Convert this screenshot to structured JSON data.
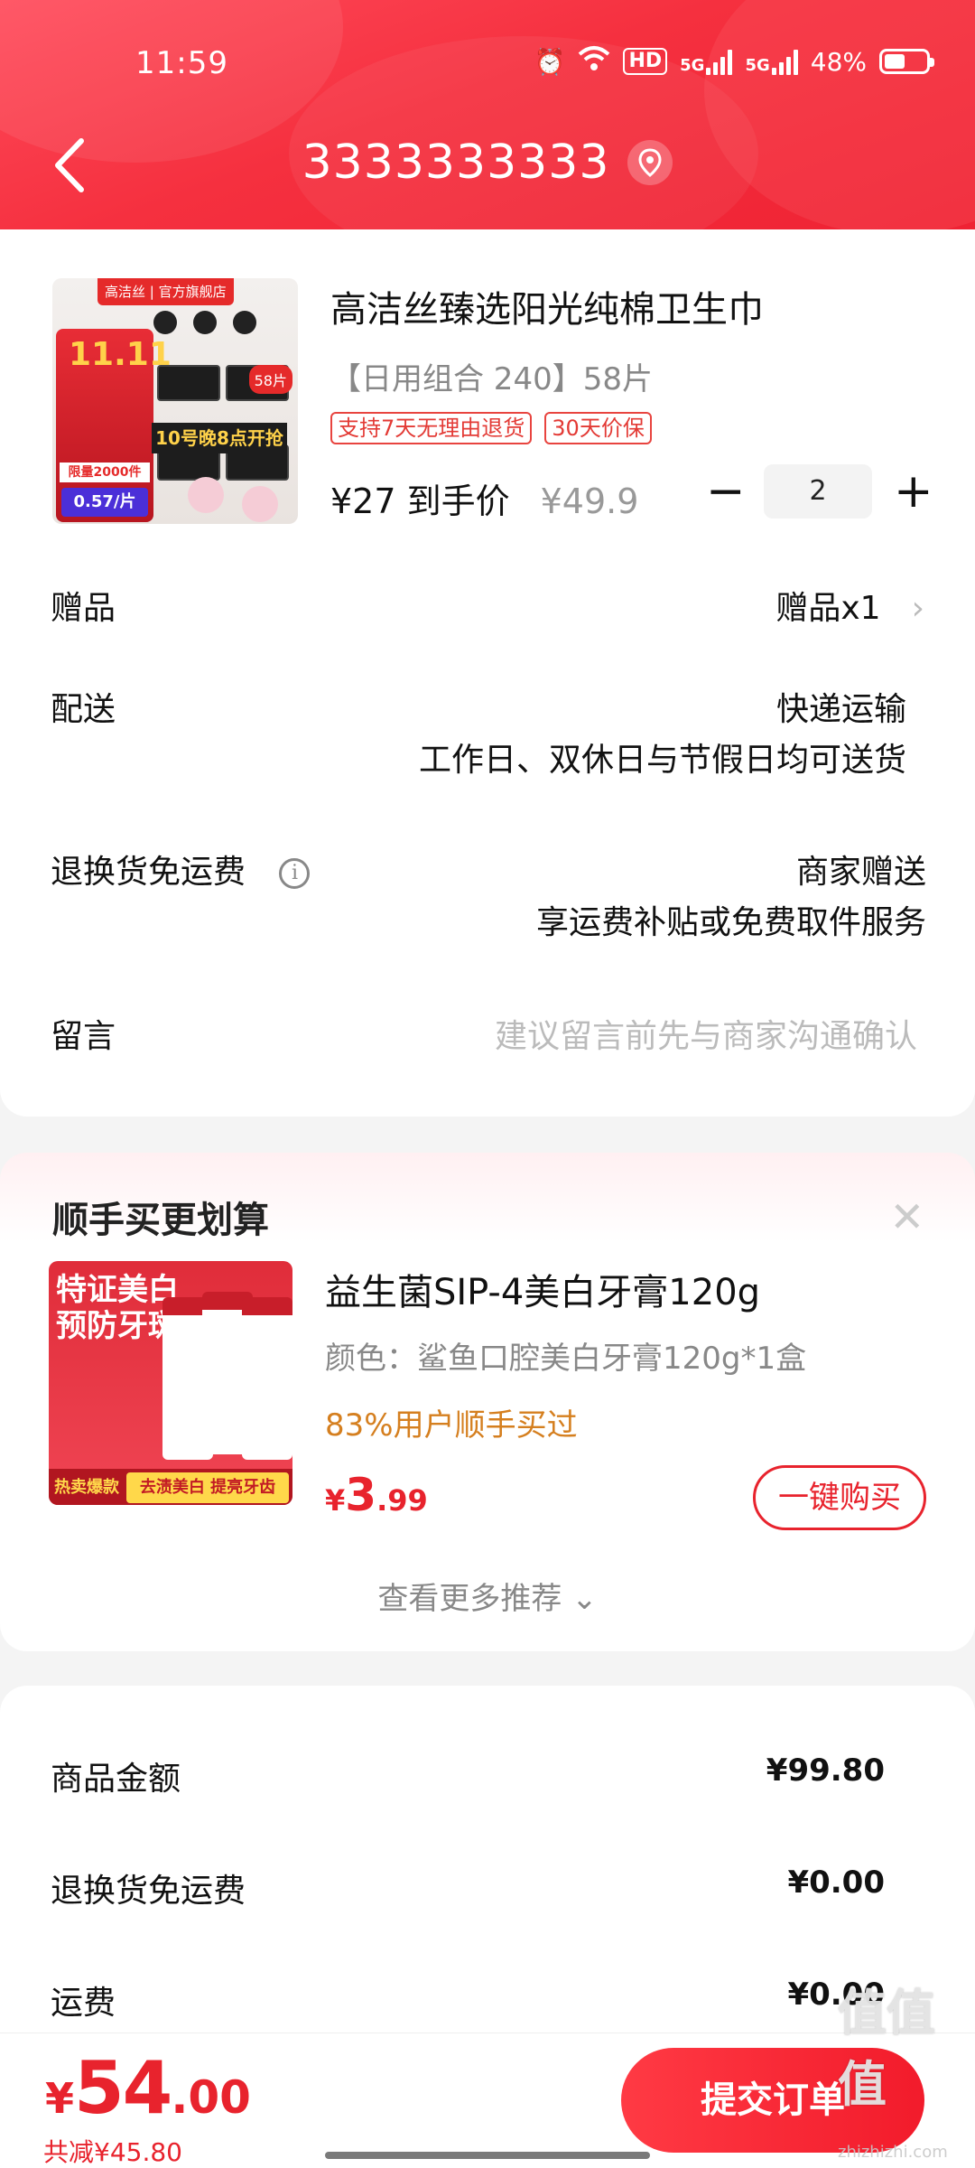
{
  "status_bar": {
    "time": "11:59",
    "hd": "HD",
    "net1": "5G",
    "net2": "5G",
    "battery": "48%"
  },
  "header": {
    "title": "3333333333"
  },
  "product": {
    "title": "高洁丝臻选阳光纯棉卫生巾",
    "spec": "【日用组合 240】58片",
    "tags": [
      "支持7天无理由退货",
      "30天价保"
    ],
    "final_price": "¥27 到手价",
    "original_price": "¥49.9",
    "quantity": "2",
    "minus": "−",
    "plus": "+",
    "image": {
      "store_tag": "高洁丝 | 官方旗舰店",
      "promo": "11.11",
      "limit": "限量2000件",
      "unit_price": "0.57/片",
      "count": "58片",
      "event": "10号晚8点开抢"
    }
  },
  "details": {
    "gift_label": "赠品",
    "gift_value": "赠品x1",
    "delivery_label": "配送",
    "delivery_value": "快递运输",
    "delivery_sub": "工作日、双休日与节假日均可送货",
    "return_label": "退换货免运费",
    "return_value": "商家赠送",
    "return_sub": "享运费补贴或免费取件服务",
    "message_label": "留言",
    "message_placeholder": "建议留言前先与商家沟通确认"
  },
  "recommend": {
    "title": "顺手买更划算",
    "item_title": "益生菌SIP-4美白牙膏120g",
    "item_spec": "颜色：鲨鱼口腔美白牙膏120g*1盒",
    "item_note": "83%用户顺手买过",
    "price_currency": "¥",
    "price_int": "3",
    "price_dec": ".99",
    "buy_label": "一键购买",
    "more_label": "查看更多推荐 ⌄",
    "image": {
      "headline": "特证美白\n预防牙斑",
      "badge": "热卖爆款",
      "slogan": "去渍美白 提亮牙齿"
    }
  },
  "summary": {
    "rows": [
      {
        "label": "商品金额",
        "value": "¥99.80"
      },
      {
        "label": "退换货免运费",
        "value": "¥0.00"
      },
      {
        "label": "运费",
        "value": "¥0.00"
      }
    ]
  },
  "bottom": {
    "currency": "¥",
    "total_int": "54",
    "total_dec": ".00",
    "saved": "共减¥45.80",
    "submit_label": "提交订单"
  },
  "watermark": {
    "text": "值值值",
    "sub": "zhizhizhi.com"
  },
  "colors": {
    "brand_red": "#f5303f",
    "price_red": "#e8232d",
    "orange_note": "#d57f1f"
  }
}
